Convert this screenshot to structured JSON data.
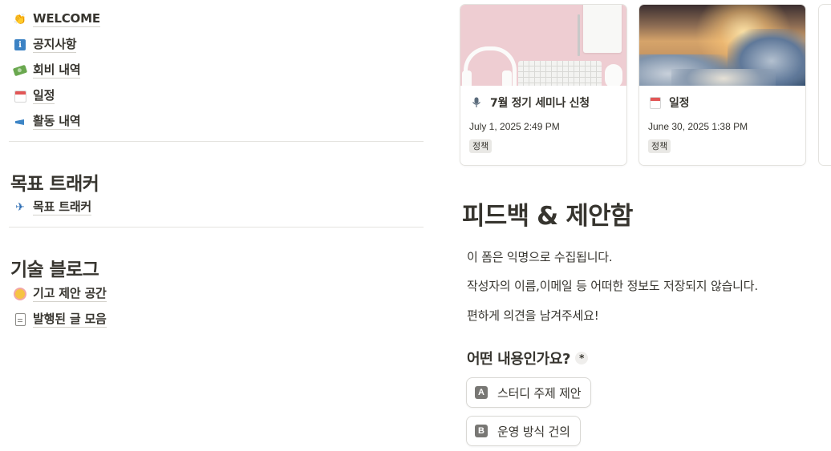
{
  "nav": {
    "items": [
      {
        "icon": "clapping-hands-icon",
        "label": "WELCOME"
      },
      {
        "icon": "info-icon",
        "label": "공지사항"
      },
      {
        "icon": "money-icon",
        "label": "회비 내역"
      },
      {
        "icon": "calendar-icon",
        "label": "일정"
      },
      {
        "icon": "megaphone-icon",
        "label": "활동 내역"
      }
    ]
  },
  "goals": {
    "heading": "목표 트래커",
    "items": [
      {
        "icon": "airplane-icon",
        "label": "목표 트래커"
      }
    ]
  },
  "blog": {
    "heading": "기술 블로그",
    "items": [
      {
        "icon": "flower-icon",
        "label": "기고 제안 공간"
      },
      {
        "icon": "document-icon",
        "label": "발행된 글 모음"
      }
    ]
  },
  "cards": [
    {
      "icon": "microphone-icon",
      "title": "7월 정기 세미나 신청",
      "date": "July 1, 2025 2:49 PM",
      "tag": "정책"
    },
    {
      "icon": "calendar-icon",
      "title": "일정",
      "date": "June 30, 2025 1:38 PM",
      "tag": "정책"
    }
  ],
  "form": {
    "title": "피드백 & 제안함",
    "description": [
      "이 폼은 익명으로 수집됩니다.",
      "작성자의 이름,이메일 등 어떠한 정보도 저장되지 않습니다.",
      "편하게 의견을 남겨주세요!"
    ],
    "question": "어떤 내용인가요?",
    "required_mark": "*",
    "options": [
      {
        "key": "A",
        "label": "스터디 주제 제안"
      },
      {
        "key": "B",
        "label": "운영 방식 건의"
      }
    ]
  }
}
